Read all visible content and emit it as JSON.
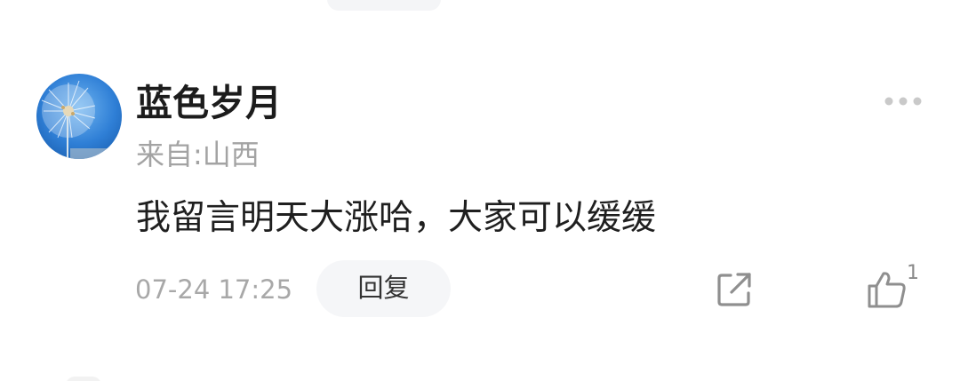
{
  "comment_card": {
    "username": "蓝色岁月",
    "location": "来自:山西",
    "text": "我留言明天大涨哈，大家可以缓缓",
    "timestamp": "07-24 17:25",
    "reply_label": "回复",
    "like_count": "1"
  },
  "icons": {
    "avatar": "dandelion-photo",
    "more": "more-dots-icon",
    "share": "share-icon",
    "like": "thumbs-up-icon"
  },
  "colors": {
    "text_primary": "#1c1c1c",
    "text_secondary": "#a3a3a3",
    "reply_bg": "#f5f6f8",
    "avatar_sky": "#2f7fd6"
  }
}
